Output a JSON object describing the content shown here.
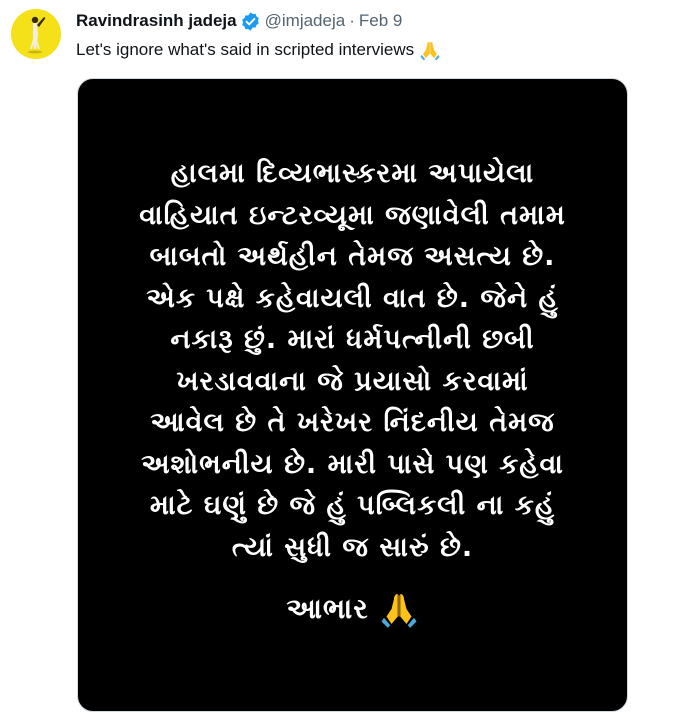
{
  "author": {
    "display_name": "Ravindrasinh jadeja",
    "handle": "@imjadeja",
    "separator": "·",
    "date": "Feb 9",
    "avatar_icon": "avatar-icon",
    "verified_icon": "verified-badge-icon"
  },
  "tweet": {
    "text": "Let's ignore what's said in scripted interviews",
    "emoji": "pray-emoji-icon"
  },
  "media": {
    "lines": [
      "હાલમા દિવ્યભાસ્કરમા અપાયેલા",
      "વાહિયાત ઇન્ટરવ્યૂમા જણાવેલી તમામ",
      "બાબતો અર્થહીન તેમજ અસત્ય છે.",
      "એક પક્ષે કહેવાયલી વાત છે. જેને હું",
      "નકારૂ છું. મારાં ધર્મપત્નીની છબી",
      "ખરડાવવાના જે પ્રયાસો કરવામાં",
      "આવેલ છે તે ખરેખર નિંદનીય તેમજ",
      "અશોભનીય છે. મારી પાસે પણ કહેવા",
      "માટે ઘણું છે જે હું પબ્લિકલી ના કહું",
      "ત્યાં સુધી જ સારું છે."
    ],
    "thanks": "આભાર",
    "thanks_emoji": "pray-emoji-icon"
  },
  "colors": {
    "verified": "#1d9bf0",
    "secondary_text": "#536471",
    "avatar_bg": "#f5e11a",
    "media_bg": "#000000"
  }
}
